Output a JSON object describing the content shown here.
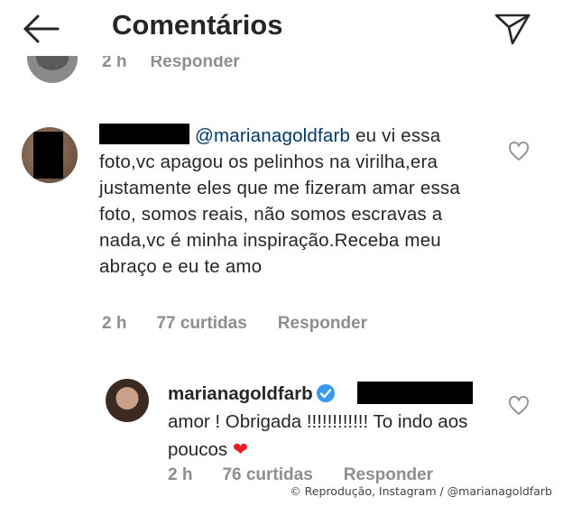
{
  "header": {
    "title": "Comentários",
    "back_icon": "arrow-left-icon",
    "share_icon": "send-icon"
  },
  "previous_comment": {
    "time": "2 h",
    "reply_label": "Responder"
  },
  "comment": {
    "mention": "@marianagoldfarb",
    "text": "eu vi essa foto,vc apagou os pelinhos na virilha,era justamente eles que me fizeram amar essa foto, somos reais, não somos escravas a nada,vc é minha inspiração.Receba meu abraço e eu te amo",
    "time": "2 h",
    "likes": "77 curtidas",
    "reply_label": "Responder"
  },
  "reply": {
    "username": "marianagoldfarb",
    "text": "amor ! Obrigada !!!!!!!!!!!! To indo aos poucos",
    "emoji": "❤",
    "time": "2 h",
    "likes": "76 curtidas",
    "reply_label": "Responder"
  },
  "credit": "© Reprodução, Instagram / @marianagoldfarb",
  "colors": {
    "text": "#262626",
    "muted": "#8e8e8e",
    "mention": "#00376b",
    "verified": "#3897f0",
    "heart": "#ed1c24"
  }
}
